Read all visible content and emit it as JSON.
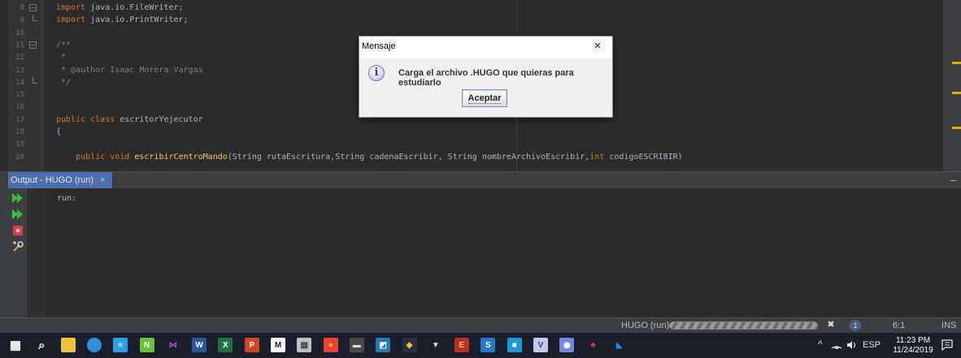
{
  "editor": {
    "lines": [
      {
        "n": "8",
        "html": "<span class=\"kw\">import</span> <span class=\"tx\">java.io.FileWriter;</span>"
      },
      {
        "n": "9",
        "html": "<span class=\"kw\">import</span> <span class=\"tx\">java.io.PrintWriter;</span>"
      },
      {
        "n": "10",
        "html": ""
      },
      {
        "n": "11",
        "html": "<span class=\"cm\">/**</span>"
      },
      {
        "n": "12",
        "html": "<span class=\"cm\"> *</span>"
      },
      {
        "n": "13",
        "html": "<span class=\"cm\"> * @author Isaac Morera Vargas</span>"
      },
      {
        "n": "14",
        "html": "<span class=\"cm\"> */</span>"
      },
      {
        "n": "15",
        "html": ""
      },
      {
        "n": "16",
        "html": ""
      },
      {
        "n": "17",
        "html": "<span class=\"kw\">public class</span> <span class=\"tx\">escritorYejecutor</span>"
      },
      {
        "n": "18",
        "html": "<span class=\"tx\">{</span>"
      },
      {
        "n": "19",
        "html": ""
      },
      {
        "n": "20",
        "html": "    <span class=\"kw\">public void</span> <span class=\"fn\">escribirCentroMando</span><span class=\"tx\">(String rutaEscritura,String cadenaEscribir, String nombreArchivoEscribir,</span><span class=\"kw\">int</span> <span class=\"tx\">codigoESCRIBIR)</span>"
      }
    ]
  },
  "output": {
    "tab_label": "Output - HUGO (run)",
    "close_label": "×",
    "minimize_label": "–",
    "text": "run:"
  },
  "status": {
    "run_label": "HUGO (run)",
    "close_label": "✖",
    "notification_count": "1",
    "position": "6:1",
    "mode": "INS"
  },
  "dialog": {
    "title": "Mensaje",
    "close_label": "×",
    "icon_glyph": "i",
    "message": "Carga el archivo .HUGO que quieras para estudiarlo",
    "button": "Aceptar"
  },
  "taskbar": {
    "language": "ESP",
    "time": "11:23 PM",
    "date": "11/24/2019",
    "tray_chevron": "^",
    "apps": [
      {
        "icon": "windows-start-icon",
        "glyph": "▦",
        "bg": "transparent",
        "color": "#ffffff"
      },
      {
        "icon": "search-icon",
        "glyph": "⌕",
        "bg": "transparent",
        "color": "#ffffff"
      },
      {
        "icon": "file-explorer-icon",
        "glyph": "",
        "bg": "#f0c040",
        "color": "#ffffff"
      },
      {
        "icon": "edge-icon",
        "glyph": "",
        "bg": "#2e90d8",
        "color": "#ffffff"
      },
      {
        "icon": "notepad-icon",
        "glyph": "≡",
        "bg": "#2aa0e0",
        "color": "#ffffff"
      },
      {
        "icon": "notepad-plus-icon",
        "glyph": "N",
        "bg": "#6cbf3c",
        "color": "#ffffff"
      },
      {
        "icon": "visual-studio-icon",
        "glyph": "⋈",
        "bg": "transparent",
        "color": "#9b59d0"
      },
      {
        "icon": "word-icon",
        "glyph": "W",
        "bg": "#2b579a",
        "color": "#ffffff"
      },
      {
        "icon": "excel-icon",
        "glyph": "X",
        "bg": "#217346",
        "color": "#ffffff"
      },
      {
        "icon": "powerpoint-icon",
        "glyph": "P",
        "bg": "#d24726",
        "color": "#ffffff"
      },
      {
        "icon": "mendeley-icon",
        "glyph": "M",
        "bg": "#ffffff",
        "color": "#1a1f2b"
      },
      {
        "icon": "calculator-icon",
        "glyph": "▤",
        "bg": "#c0c0c0",
        "color": "#333333"
      },
      {
        "icon": "chrome-icon",
        "glyph": "●",
        "bg": "#ea4335",
        "color": "#fbbc05"
      },
      {
        "icon": "terminal-icon",
        "glyph": "▬",
        "bg": "#4a4a4a",
        "color": "#dddddd"
      },
      {
        "icon": "network-tool-icon",
        "glyph": "◩",
        "bg": "#2a7ab8",
        "color": "#ffffff"
      },
      {
        "icon": "palette-icon",
        "glyph": "◆",
        "bg": "#2a2f3b",
        "color": "#f0c040"
      },
      {
        "icon": "key-tool-icon",
        "glyph": "▼",
        "bg": "transparent",
        "color": "#e0e0e0"
      },
      {
        "icon": "exe-tool-icon",
        "glyph": "E",
        "bg": "#b8302a",
        "color": "#ffd040"
      },
      {
        "icon": "sublime-tool-icon",
        "glyph": "S",
        "bg": "#2a78c8",
        "color": "#ffffff"
      },
      {
        "icon": "virtualbox-icon",
        "glyph": "■",
        "bg": "#1a9ad8",
        "color": "#ffffff"
      },
      {
        "icon": "visio-icon",
        "glyph": "V",
        "bg": "#c8c8e8",
        "color": "#2b3b8a"
      },
      {
        "icon": "discord-icon",
        "glyph": "◉",
        "bg": "#7289da",
        "color": "#ffffff"
      },
      {
        "icon": "paint-tool-icon",
        "glyph": "♣",
        "bg": "transparent",
        "color": "#d84040"
      },
      {
        "icon": "vs-code-icon",
        "glyph": "◣",
        "bg": "transparent",
        "color": "#2a8ae0"
      }
    ]
  }
}
